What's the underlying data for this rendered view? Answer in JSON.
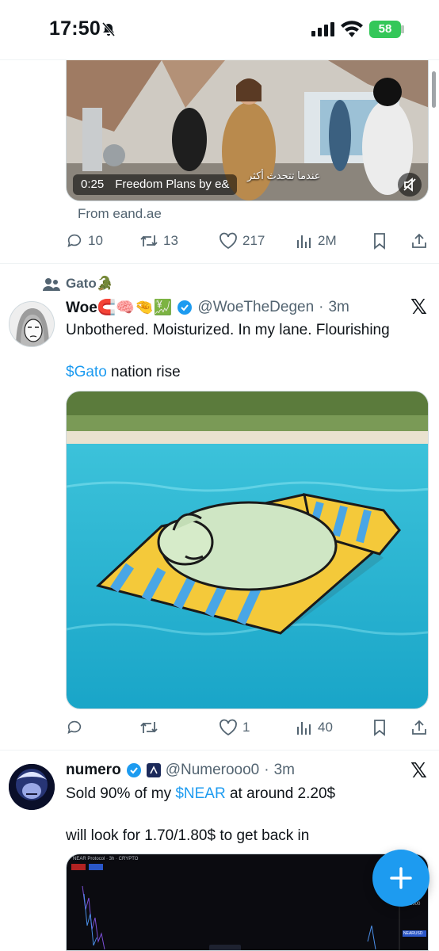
{
  "status_bar": {
    "time": "17:50",
    "battery": "58"
  },
  "video_card": {
    "duration": "0:25",
    "title": "Freedom Plans by e&",
    "caption_arabic": "عندما تتحدث أكثر",
    "source": "From eand.ae"
  },
  "tweet1_actions": {
    "replies": "10",
    "retweets": "13",
    "likes": "217",
    "views": "2M"
  },
  "tweet2": {
    "community": "Gato🐊",
    "name": "Woe🧲🧠🤏💹",
    "handle": "@WoeTheDegen",
    "time": "3m",
    "line1": "Unbothered. Moisturized. In my lane. Flourishing",
    "cashtag": "$Gato",
    "line2_rest": " nation rise",
    "actions": {
      "replies": "",
      "retweets": "",
      "likes": "1",
      "views": "40"
    }
  },
  "tweet3": {
    "name": "numero",
    "handle": "@Numerooo0",
    "time": "3m",
    "line1_pre": "Sold 90% of my ",
    "cashtag": "$NEAR",
    "line1_post": " at around 2.20$",
    "line2": "will look for 1.70/1.80$ to get back in",
    "chart_header": "NEAR Protocol · 3h · CRYPTO",
    "chart_price": "2.3000",
    "chart_badge": "NEARUSD"
  },
  "separator_dot": "·",
  "colors": {
    "accent": "#1d9bf0",
    "text": "#0f1419",
    "muted": "#536471",
    "battery": "#34c759"
  }
}
